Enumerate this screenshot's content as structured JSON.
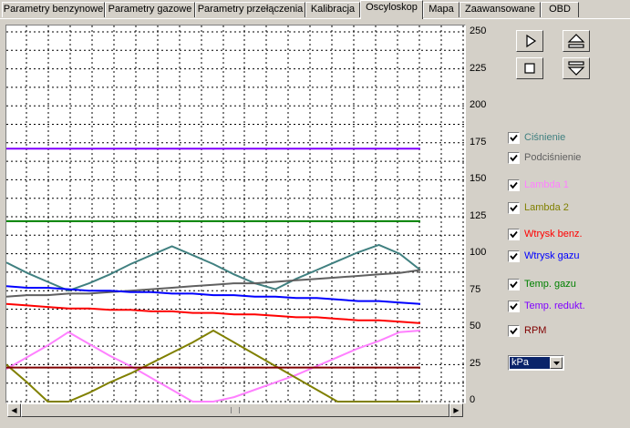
{
  "tabs": [
    {
      "label": "Parametry benzynowe",
      "active": false
    },
    {
      "label": "Parametry gazowe",
      "active": false
    },
    {
      "label": "Parametry przełączenia",
      "active": false
    },
    {
      "label": "Kalibracja",
      "active": false
    },
    {
      "label": "Oscyloskop",
      "active": true
    },
    {
      "label": "Mapa",
      "active": false
    },
    {
      "label": "Zaawansowane",
      "active": false
    },
    {
      "label": "OBD",
      "active": false
    }
  ],
  "controls": {
    "play_icon": "play-icon",
    "stop_icon": "stop-icon",
    "scale_up_icon": "scale-up-icon",
    "scale_down_icon": "scale-down-icon"
  },
  "legend": [
    {
      "label": "Ciśnienie",
      "checked": true,
      "color": "#408080"
    },
    {
      "label": "Podciśnienie",
      "checked": true,
      "color": "#606060"
    },
    {
      "label": "Lambda 1",
      "checked": true,
      "color": "#ff80ff"
    },
    {
      "label": "Lambda 2",
      "checked": true,
      "color": "#808000"
    },
    {
      "label": "Wtrysk benz.",
      "checked": true,
      "color": "#ff0000"
    },
    {
      "label": "Wtrysk gazu",
      "checked": true,
      "color": "#0000ff"
    },
    {
      "label": "Temp. gazu",
      "checked": true,
      "color": "#008000"
    },
    {
      "label": "Temp. redukt.",
      "checked": true,
      "color": "#8000ff"
    },
    {
      "label": "RPM",
      "checked": true,
      "color": "#800000"
    }
  ],
  "unit_select": {
    "value": "kPa"
  },
  "chart_data": {
    "type": "line",
    "ylim": [
      0,
      250
    ],
    "y_ticks": [
      "250",
      "225",
      "200",
      "175",
      "150",
      "125",
      "100",
      "75",
      "50",
      "25",
      "0"
    ],
    "grid": true,
    "x": [
      0,
      1,
      2,
      3,
      4,
      5,
      6,
      7,
      8,
      9,
      10,
      11,
      12,
      13,
      14,
      15,
      16,
      17,
      18,
      19,
      20
    ],
    "series": [
      {
        "color": "#408080",
        "values": [
          94,
          87,
          81,
          75,
          80,
          86,
          93,
          99,
          105,
          99,
          93,
          86,
          80,
          76,
          83,
          89,
          95,
          101,
          106,
          100,
          89
        ]
      },
      {
        "color": "#606060",
        "values": [
          71,
          72,
          72,
          73,
          73,
          74,
          75,
          76,
          77,
          78,
          79,
          80,
          80,
          81,
          82,
          83,
          84,
          85,
          86,
          87,
          89
        ]
      },
      {
        "color": "#ff80ff",
        "values": [
          22,
          30,
          38,
          47,
          39,
          31,
          24,
          16,
          8,
          0,
          0,
          3,
          8,
          13,
          18,
          24,
          30,
          36,
          41,
          47,
          48
        ]
      },
      {
        "color": "#808000",
        "values": [
          25,
          13,
          0,
          0,
          6,
          13,
          19,
          26,
          33,
          40,
          48,
          40,
          32,
          24,
          16,
          8,
          0,
          0,
          0,
          0,
          0
        ]
      },
      {
        "color": "#ff0000",
        "values": [
          66,
          65,
          64,
          63,
          63,
          62,
          62,
          61,
          61,
          60,
          60,
          59,
          59,
          58,
          57,
          57,
          56,
          55,
          55,
          54,
          53
        ]
      },
      {
        "color": "#0000ff",
        "values": [
          78,
          77,
          77,
          76,
          75,
          75,
          74,
          74,
          73,
          73,
          72,
          72,
          71,
          71,
          70,
          70,
          69,
          68,
          68,
          67,
          66
        ]
      },
      {
        "color": "#008000",
        "values": [
          122,
          122,
          122,
          122,
          122,
          122,
          122,
          122,
          122,
          122,
          122,
          122,
          122,
          122,
          122,
          122,
          122,
          122,
          122,
          122,
          122
        ]
      },
      {
        "color": "#8000ff",
        "values": [
          171,
          171,
          171,
          171,
          171,
          171,
          171,
          171,
          171,
          171,
          171,
          171,
          171,
          171,
          171,
          171,
          171,
          171,
          171,
          171,
          171
        ]
      },
      {
        "color": "#800000",
        "values": [
          23,
          23,
          23,
          23,
          23,
          23,
          23,
          23,
          23,
          23,
          23,
          23,
          23,
          23,
          23,
          23,
          23,
          23,
          23,
          23,
          23
        ]
      }
    ]
  }
}
